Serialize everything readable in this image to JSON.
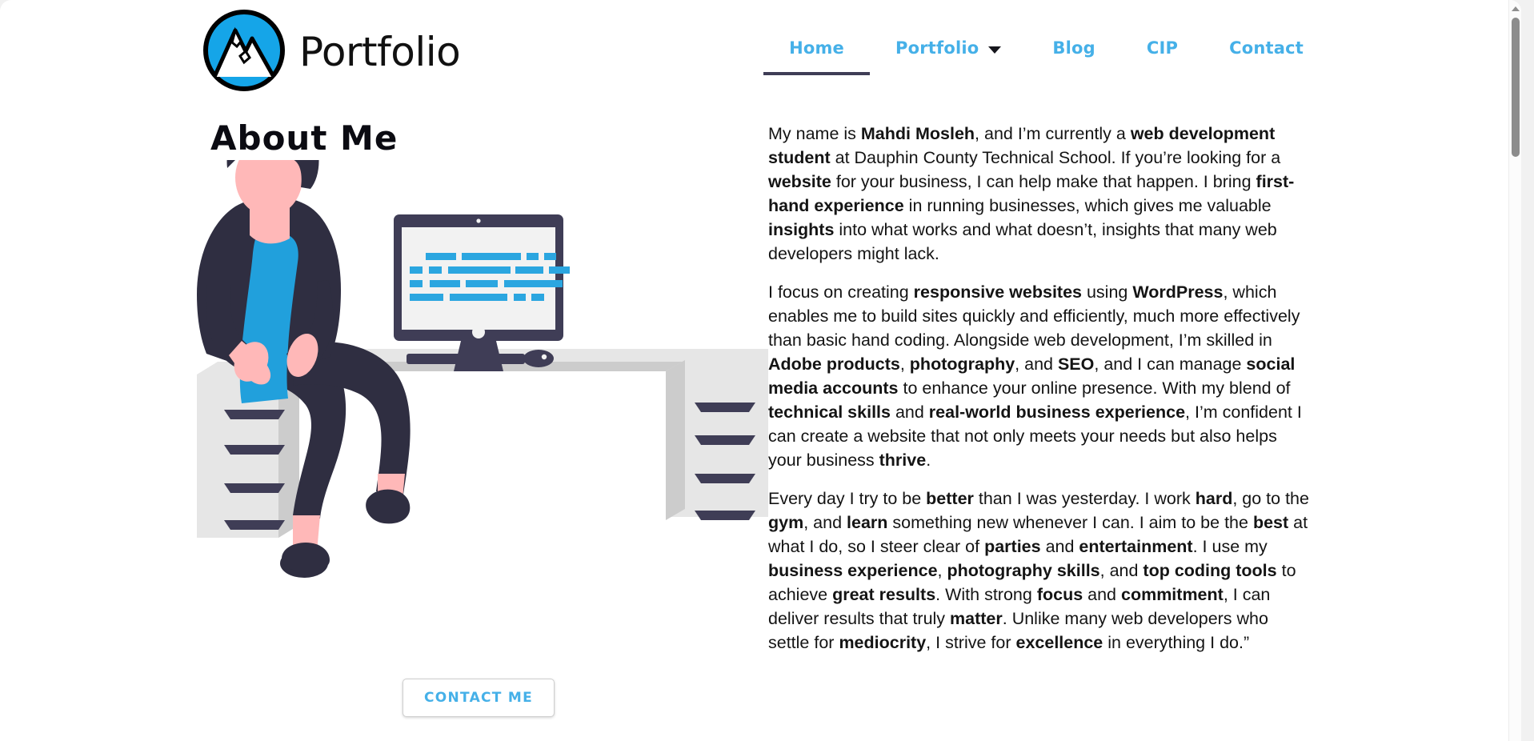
{
  "brand": {
    "name": "Portfolio",
    "logo_icon": "mountain-circle-logo",
    "logo_circle_color": "#15A5E8",
    "logo_outline_color": "#000000"
  },
  "nav": {
    "accent_color": "#45B0E8",
    "active_underline_color": "#3F3D56",
    "items": [
      {
        "label": "Home",
        "active": true,
        "has_dropdown": false
      },
      {
        "label": "Portfolio",
        "active": false,
        "has_dropdown": true
      },
      {
        "label": "Blog",
        "active": false,
        "has_dropdown": false
      },
      {
        "label": "CIP",
        "active": false,
        "has_dropdown": false
      },
      {
        "label": "Contact",
        "active": false,
        "has_dropdown": false
      }
    ]
  },
  "main": {
    "title": "About Me",
    "contact_button_label": "CONTACT ME",
    "illustration_icon": "man-sitting-at-desk-illustration",
    "paragraphs": [
      "My name is <b>Mahdi Mosleh</b>, and I’m currently a <b>web development student</b> at Dauphin County Technical School. If you’re looking for a <b>website</b> for your business, I can help make that happen. I bring <b>first-hand experience</b> in running businesses, which gives me valuable <b>insights</b> into what works and what doesn’t, insights that many web developers might lack.",
      "I focus on creating <b>responsive websites</b> using <b>WordPress</b>, which enables me to build sites quickly and efficiently, much more effectively than basic hand coding. Alongside web development, I’m skilled in <b>Adobe products</b>, <b>photography</b>, and <b>SEO</b>, and I can manage <b>social media accounts</b> to enhance your online presence. With my blend of <b>technical skills</b> and <b>real-world business experience</b>, I’m confident I can create a website that not only meets your needs but also helps your business <b>thrive</b>.",
      "Every day I try to be <b>better</b> than I was yesterday. I work <b>hard</b>, go to the <b>gym</b>, and <b>learn</b> something new whenever I can. I aim to be the <b>best</b> at what I do, so I steer clear of <b>parties</b> and <b>entertainment</b>. I use my <b>business experience</b>, <b>photography skills</b>, and <b>top coding tools</b> to achieve <b>great results</b>. With strong <b>focus</b> and <b>commitment</b>, I can deliver results that truly <b>matter</b>. Unlike many web developers who settle for <b>mediocrity</b>, I strive for <b>excellence</b> in everything I do.”"
    ]
  },
  "scrollbar": {
    "thumb_color": "#8C8C8C",
    "up_arrow_icon": "scroll-up-arrow-icon"
  },
  "palette": {
    "accent_blue": "#45B0E8",
    "logo_blue": "#15A5E8",
    "dark_navy": "#2F2E41",
    "monitor_bezel": "#3F3D56",
    "skin": "#FFB8B8",
    "shirt_blue": "#21A0DC",
    "desk_light": "#E6E6E6",
    "desk_shade": "#CCCCCC",
    "screen_bg": "#F2F2F2",
    "code_blue": "#2BA6E0"
  }
}
